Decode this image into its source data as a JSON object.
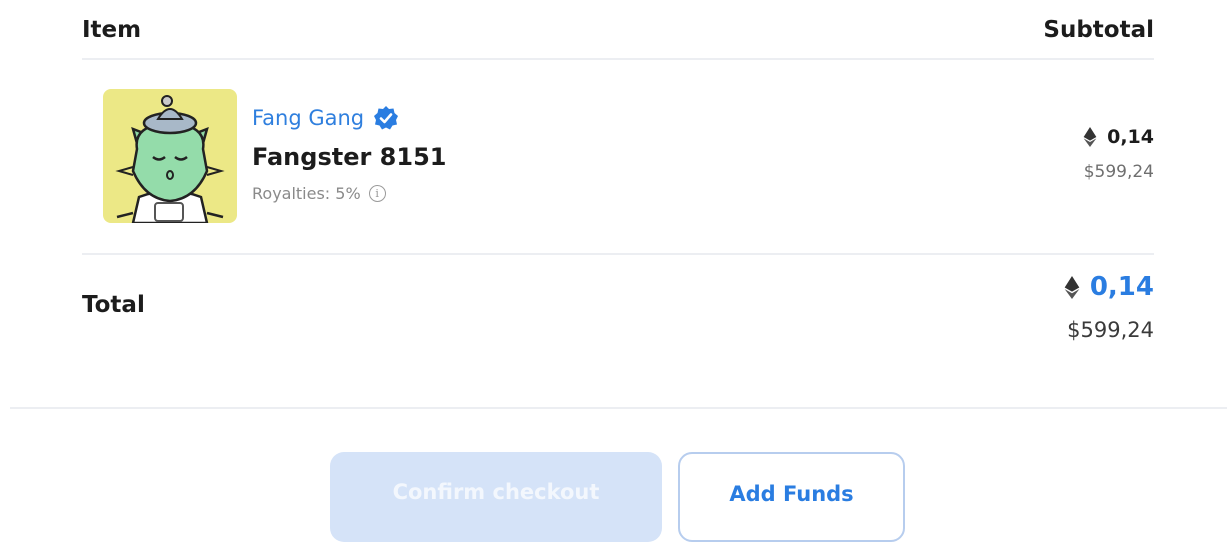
{
  "header": {
    "item_label": "Item",
    "subtotal_label": "Subtotal"
  },
  "item": {
    "collection": "Fang Gang",
    "verified_icon": "verified-badge-icon",
    "name": "Fangster 8151",
    "royalties": "Royalties: 5%",
    "info_icon": "info-icon",
    "price_eth": "0,14",
    "price_usd": "$599,24",
    "currency_icon": "ethereum-icon"
  },
  "total": {
    "label": "Total",
    "price_eth": "0,14",
    "price_usd": "$599,24"
  },
  "actions": {
    "confirm_label": "Confirm checkout",
    "add_funds_label": "Add Funds"
  },
  "colors": {
    "accent": "#2a7de1",
    "thumbnail_bg": "#ece886",
    "confirm_disabled_bg": "#d5e3f8"
  }
}
